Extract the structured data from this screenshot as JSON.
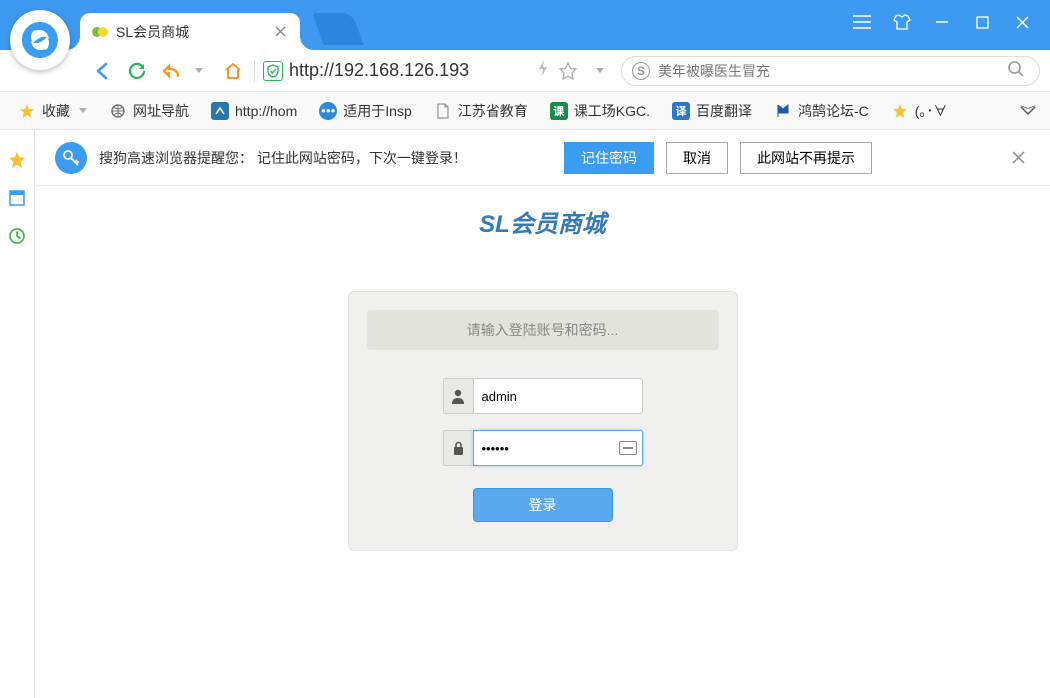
{
  "tab": {
    "title": "SL会员商城"
  },
  "address": {
    "url": "http://192.168.126.193"
  },
  "search": {
    "placeholder": "美年被曝医生冒充"
  },
  "bookmarks": {
    "favorites_label": "收藏",
    "items": [
      {
        "label": "网址导航"
      },
      {
        "label": "http://hom"
      },
      {
        "label": "适用于Insp"
      },
      {
        "label": "江苏省教育"
      },
      {
        "label": "课工场KGC."
      },
      {
        "label": "百度翻译"
      },
      {
        "label": "鸿鹄论坛-C"
      },
      {
        "label": "(｡･∀"
      }
    ]
  },
  "notify": {
    "message": "搜狗高速浏览器提醒您： 记住此网站密码，下次一键登录！",
    "remember": "记住密码",
    "cancel": "取消",
    "dismiss": "此网站不再提示"
  },
  "login": {
    "page_title": "SL会员商城",
    "header": "请输入登陆账号和密码...",
    "username": "admin",
    "password": "••••••",
    "button": "登录"
  }
}
